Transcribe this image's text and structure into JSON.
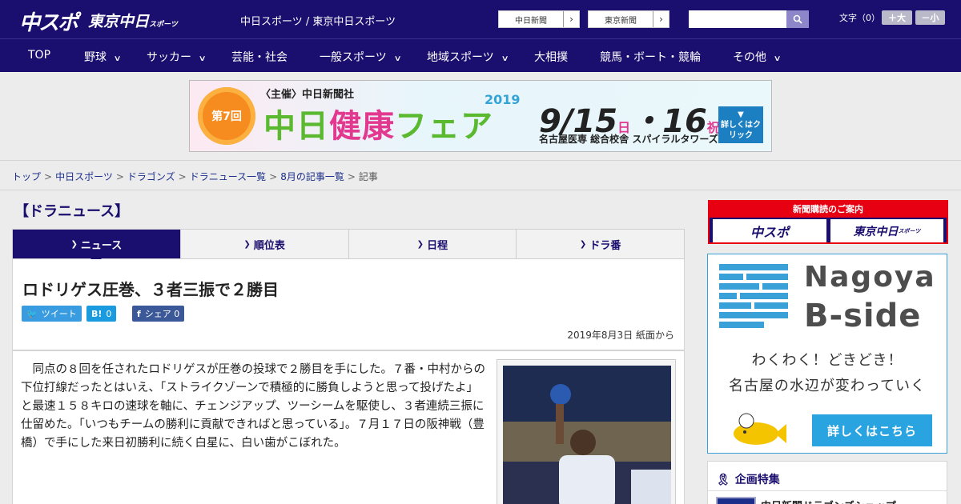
{
  "header": {
    "logo_main": "中スポ",
    "logo_tokyo": "東京中日",
    "logo_tokyo_small": "スポーツ",
    "site_title": "中日スポーツ / 東京中日スポーツ",
    "ext_links": [
      "中日新聞",
      "東京新聞"
    ],
    "search_placeholder": "",
    "font_size_label": "文字（0）",
    "font_larger": "＋大",
    "font_smaller": "－小"
  },
  "nav": {
    "items": [
      {
        "label": "TOP",
        "has_menu": false
      },
      {
        "label": "野球",
        "has_menu": true
      },
      {
        "label": "サッカー",
        "has_menu": true
      },
      {
        "label": "芸能・社会",
        "has_menu": false
      },
      {
        "label": "一般スポーツ",
        "has_menu": true
      },
      {
        "label": "地域スポーツ",
        "has_menu": true
      },
      {
        "label": "大相撲",
        "has_menu": false
      },
      {
        "label": "競馬・ボート・競輪",
        "has_menu": false
      },
      {
        "label": "その他",
        "has_menu": true
      }
    ]
  },
  "banner": {
    "badge": "第7回",
    "sponsor": "〈主催〉中日新聞社",
    "title_a": "中日",
    "title_b": "健康",
    "title_c": "フェア",
    "year": "2019",
    "date": "9/15",
    "date_day1": "日",
    "date_sep": "・16",
    "date_day2": "祝",
    "venue": "名古屋医専 総合校舎 スパイラルタワーズ",
    "click": "詳しくはクリック"
  },
  "breadcrumb": {
    "links": [
      "トップ",
      "中日スポーツ",
      "ドラゴンズ",
      "ドラニュース一覧",
      "8月の記事一覧"
    ],
    "current": "記事"
  },
  "section_title": "【ドラニュース】",
  "tabs": [
    {
      "label": "ニュース",
      "active": true
    },
    {
      "label": "順位表",
      "active": false
    },
    {
      "label": "日程",
      "active": false
    },
    {
      "label": "ドラ番",
      "active": false
    }
  ],
  "article": {
    "title": "ロドリゲス圧巻、３者三振で２勝目",
    "tweet_label": "ツイート",
    "hatena_label": "B!",
    "hatena_count": "0",
    "fb_label": "シェア",
    "fb_count": "0",
    "date": "2019年8月3日 紙面から",
    "body": "同点の８回を任されたロドリゲスが圧巻の投球で２勝目を手にした。７番・中村からの下位打線だったとはいえ、「ストライクゾーンで積極的に勝負しようと思って投げたよ」と最速１５８キロの速球を軸に、チェンジアップ、ツーシームを駆使し、３者連続三振に仕留めた。「いつもチームの勝利に貢献できればと思っている」。７月１７日の阪神戦（豊橋）で手にした来日初勝利に続く白星に、白い歯がこぼれた。"
  },
  "sidebar": {
    "subscribe_head": "新聞購読のご案内",
    "subscribe_a": "中スポ",
    "subscribe_b": "東京中日",
    "subscribe_b_small": "スポーツ",
    "ad_title1": "Nagoya",
    "ad_title2": "B-side",
    "ad_line1": "わくわく！どきどき！",
    "ad_line2": "名古屋の水辺が変わっていく",
    "ad_button": "詳しくはこちら",
    "feature_head": "企画特集",
    "feature_item": "中日新聞ドラゴンズショップ"
  },
  "colors": {
    "brand_navy": "#1a0e6e",
    "accent_red": "#e60012",
    "ad_blue": "#29a4e0"
  }
}
